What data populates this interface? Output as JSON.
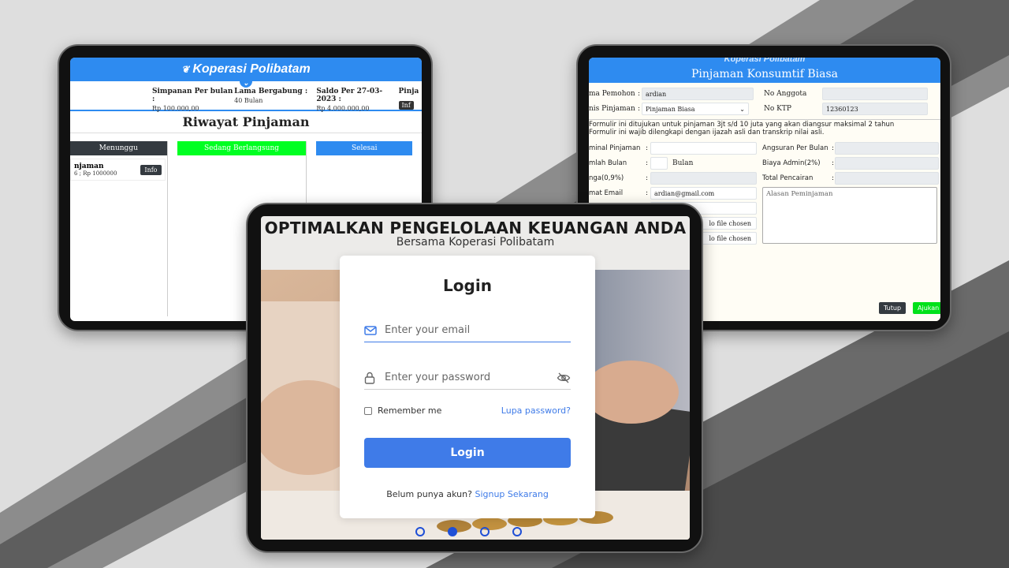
{
  "left_tablet": {
    "brand": "Koperasi Polibatam",
    "stats": [
      {
        "label": "Simpanan Per bulan :",
        "value": "Rp 100.000,00"
      },
      {
        "label": "Lama Bergabung :",
        "value": "40 Bulan"
      },
      {
        "label": "Saldo Per 27-03-2023 :",
        "value": "Rp 4.000.000,00"
      },
      {
        "label": "Pinja",
        "value": "Inf"
      }
    ],
    "title": "Riwayat Pinjaman",
    "columns": [
      "Menunggu",
      "Sedang Berlangsung",
      "Selesai"
    ],
    "loan_card": {
      "title": "njaman",
      "sub": "6 ; Rp 1000000",
      "button": "Info"
    }
  },
  "right_tablet": {
    "brand": "Koperasi Polibatam",
    "title": "Pinjaman Konsumtif Biasa",
    "fields": {
      "nama_pemohon_label": "ma Pemohon",
      "nama_pemohon_value": "ardian",
      "no_anggota_label": "No Anggota",
      "jenis_pinjaman_label": "nis Pinjaman",
      "jenis_pinjaman_value": "Pinjaman Biasa",
      "no_ktp_label": "No KTP",
      "no_ktp_value": "12360123",
      "nominal_label": "minal Pinjaman",
      "angsuran_label": "Angsuran Per Bulan",
      "jumlah_bulan_label": "mlah Bulan",
      "bulan_suffix": "Bulan",
      "biaya_admin_label": "Biaya Admin(2%)",
      "bunga_label": "nga(0,9%)",
      "total_pencairan_label": "Total Pencairan",
      "email_label": "mat Email",
      "email_value": "ardian@gmail.com",
      "alasan_placeholder": "Alasan Peminjaman",
      "file1": "lo file chosen",
      "file2": "lo file chosen"
    },
    "notes": [
      "Formulir ini ditujukan untuk pinjaman 3jt s/d 10 juta yang akan diangsur maksimal 2 tahun",
      "Formulir ini wajib dilengkapi dengan ijazah asli dan transkrip nilai asli."
    ],
    "buttons": {
      "close": "Tutup",
      "submit": "Ajukan"
    }
  },
  "front_tablet": {
    "hero_title": "OPTIMALKAN PENGELOLAAN KEUANGAN ANDA",
    "hero_sub": "Bersama Koperasi Polibatam",
    "login": {
      "title": "Login",
      "email_placeholder": "Enter your email",
      "password_placeholder": "Enter your password",
      "remember": "Remember me",
      "forgot": "Lupa password?",
      "button": "Login",
      "signup_prefix": "Belum punya akun?",
      "signup_link": "Signup Sekarang"
    },
    "carousel_active": 2
  },
  "colors": {
    "primary_blue": "#2e8bf0",
    "login_blue": "#3f7be8",
    "green": "#00ff22",
    "dark": "#343a40"
  }
}
